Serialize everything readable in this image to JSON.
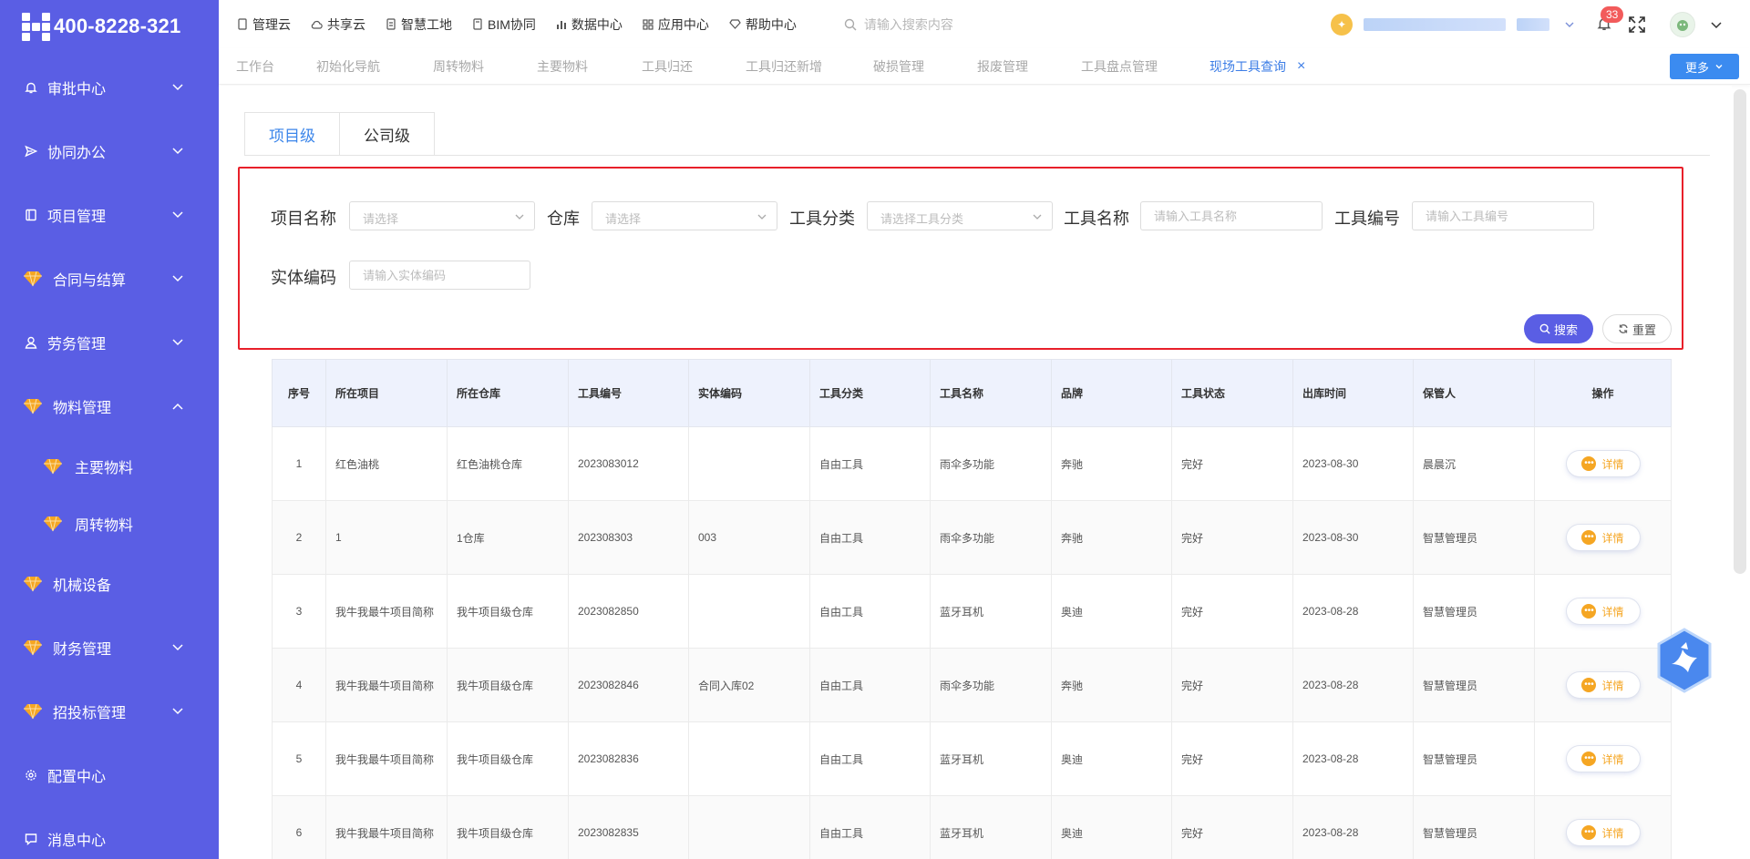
{
  "brand": {
    "phone": "400-8228-321"
  },
  "sidebar": {
    "items": [
      {
        "label": "审批中心",
        "icon": "bell-icon"
      },
      {
        "label": "协同办公",
        "icon": "send-icon"
      },
      {
        "label": "项目管理",
        "icon": "book-icon"
      },
      {
        "label": "合同与结算",
        "icon": "gem-icon"
      },
      {
        "label": "劳务管理",
        "icon": "user-icon"
      },
      {
        "label": "物料管理",
        "icon": "gem-icon",
        "expanded": true
      },
      {
        "label": "机械设备",
        "icon": "gem-icon"
      },
      {
        "label": "财务管理",
        "icon": "gem-icon"
      },
      {
        "label": "招投标管理",
        "icon": "gem-icon"
      },
      {
        "label": "配置中心",
        "icon": "gear-icon"
      },
      {
        "label": "消息中心",
        "icon": "message-icon"
      }
    ],
    "sub_items": [
      {
        "label": "主要物料"
      },
      {
        "label": "周转物料"
      }
    ]
  },
  "topnav": {
    "items": [
      {
        "label": "管理云",
        "icon": "file-icon"
      },
      {
        "label": "共享云",
        "icon": "cloud-icon"
      },
      {
        "label": "智慧工地",
        "icon": "document-icon"
      },
      {
        "label": "BIM协同",
        "icon": "file-icon"
      },
      {
        "label": "数据中心",
        "icon": "bar-chart-icon"
      },
      {
        "label": "应用中心",
        "icon": "grid-icon"
      },
      {
        "label": "帮助中心",
        "icon": "diamond-icon"
      }
    ],
    "search_placeholder": "请输入搜索内容",
    "notification_count": "33"
  },
  "tabs": {
    "items": [
      {
        "label": "工作台"
      },
      {
        "label": "初始化导航"
      },
      {
        "label": "周转物料"
      },
      {
        "label": "主要物料"
      },
      {
        "label": "工具归还"
      },
      {
        "label": "工具归还新增"
      },
      {
        "label": "破损管理"
      },
      {
        "label": "报废管理"
      },
      {
        "label": "工具盘点管理"
      },
      {
        "label": "现场工具查询",
        "active": true
      }
    ],
    "more_label": "更多"
  },
  "level_tabs": [
    "项目级",
    "公司级"
  ],
  "filters": {
    "project_name": {
      "label": "项目名称",
      "placeholder": "请选择"
    },
    "warehouse": {
      "label": "仓库",
      "placeholder": "请选择"
    },
    "tool_category": {
      "label": "工具分类",
      "placeholder": "请选择工具分类"
    },
    "tool_name": {
      "label": "工具名称",
      "placeholder": "请输入工具名称"
    },
    "tool_code": {
      "label": "工具编号",
      "placeholder": "请输入工具编号"
    },
    "entity_code": {
      "label": "实体编码",
      "placeholder": "请输入实体编码"
    },
    "search_label": "搜索",
    "reset_label": "重置"
  },
  "table": {
    "headers": [
      "序号",
      "所在项目",
      "所在仓库",
      "工具编号",
      "实体编码",
      "工具分类",
      "工具名称",
      "品牌",
      "工具状态",
      "出库时间",
      "保管人",
      "操作"
    ],
    "action_label": "详情",
    "rows": [
      [
        "1",
        "红色油桃",
        "红色油桃仓库",
        "2023083012",
        "",
        "自由工具",
        "雨伞多功能",
        "奔驰",
        "完好",
        "2023-08-30",
        "晨晨沉"
      ],
      [
        "2",
        "1",
        "1仓库",
        "202308303",
        "003",
        "自由工具",
        "雨伞多功能",
        "奔驰",
        "完好",
        "2023-08-30",
        "智慧管理员"
      ],
      [
        "3",
        "我牛我最牛项目简称",
        "我牛项目级仓库",
        "2023082850",
        "",
        "自由工具",
        "蓝牙耳机",
        "奥迪",
        "完好",
        "2023-08-28",
        "智慧管理员"
      ],
      [
        "4",
        "我牛我最牛项目简称",
        "我牛项目级仓库",
        "2023082846",
        "合同入库02",
        "自由工具",
        "雨伞多功能",
        "奔驰",
        "完好",
        "2023-08-28",
        "智慧管理员"
      ],
      [
        "5",
        "我牛我最牛项目简称",
        "我牛项目级仓库",
        "2023082836",
        "",
        "自由工具",
        "蓝牙耳机",
        "奥迪",
        "完好",
        "2023-08-28",
        "智慧管理员"
      ],
      [
        "6",
        "我牛我最牛项目简称",
        "我牛项目级仓库",
        "2023082835",
        "",
        "自由工具",
        "蓝牙耳机",
        "奥迪",
        "完好",
        "2023-08-28",
        "智慧管理员"
      ]
    ]
  },
  "colors": {
    "sidebar": "#5a5ee4",
    "accent": "#3c86ea",
    "highlight_border": "#e8202a",
    "action": "#f5a623"
  }
}
